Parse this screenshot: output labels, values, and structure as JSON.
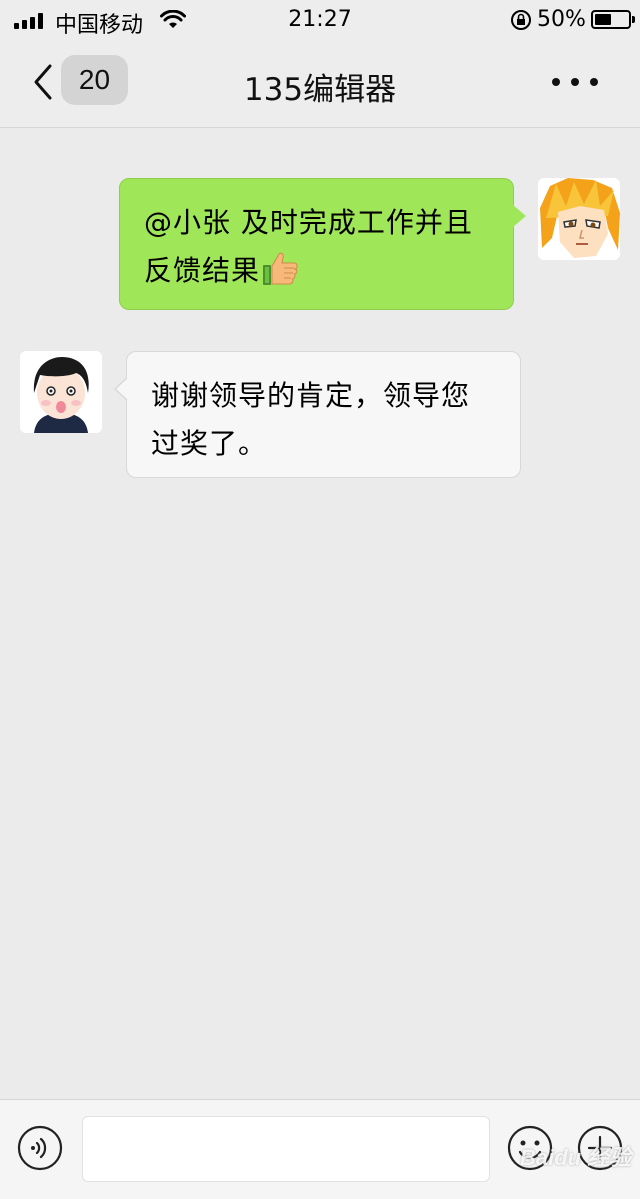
{
  "status_bar": {
    "carrier": "中国移动",
    "time": "21:27",
    "battery_percent": "50%",
    "battery_level": 0.5,
    "icons": [
      "signal-icon",
      "wifi-icon",
      "rotation-lock-icon",
      "battery-icon"
    ]
  },
  "nav": {
    "unread_count": "20",
    "title": "135编辑器",
    "icons": [
      "back-chevron-icon",
      "more-dots-icon"
    ]
  },
  "messages": [
    {
      "side": "right",
      "text": "@小张 及时完成工作并且反馈结果",
      "emoji": "thumbs-up-icon",
      "bubble_color": "#9fe658",
      "avatar": "anime-boy-avatar"
    },
    {
      "side": "left",
      "text": "谢谢领导的肯定，领导您过奖了。",
      "bubble_color": "#f7f7f7",
      "avatar": "cartoon-person-avatar"
    }
  ],
  "input_bar": {
    "value": "",
    "icons": [
      "voice-icon",
      "emoji-icon",
      "plus-icon"
    ]
  },
  "watermark": "Baidu 经验"
}
